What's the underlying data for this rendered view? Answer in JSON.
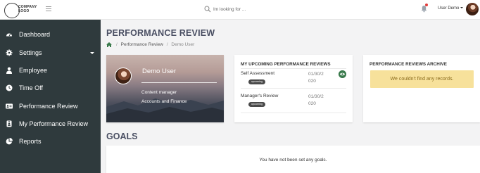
{
  "header": {
    "logo_text_line1": "COMPANY",
    "logo_text_line2": "LOGO",
    "search_placeholder": "Im looking for ...",
    "user_name": "User Demo"
  },
  "sidebar": {
    "items": [
      {
        "label": "Dashboard",
        "icon": "dashboard-icon"
      },
      {
        "label": "Settings",
        "icon": "gear-icon"
      },
      {
        "label": "Employee",
        "icon": "employee-icon"
      },
      {
        "label": "Time Off",
        "icon": "clock-icon"
      },
      {
        "label": "Performance Review",
        "icon": "id-card-icon"
      },
      {
        "label": "My Performance Review",
        "icon": "id-badge-icon"
      },
      {
        "label": "Reports",
        "icon": "pie-chart-icon"
      }
    ]
  },
  "page": {
    "title": "PERFORMANCE REVIEW",
    "breadcrumb": {
      "separator": "/",
      "item1": "Performance Review",
      "item2": "Demo User"
    }
  },
  "profile": {
    "name": "Demo User",
    "role": "Content manager",
    "department": "Accounts and Finance"
  },
  "upcoming": {
    "title": "MY UPCOMING PERFORMANCE REVIEWS",
    "reviews": [
      {
        "name": "Self Assessment",
        "badge": "upcoming",
        "date_line1": "01/30/2",
        "date_line2": "020"
      },
      {
        "name": "Manager's Review",
        "badge": "upcoming",
        "date_line1": "01/30/2",
        "date_line2": "020"
      }
    ]
  },
  "archive": {
    "title": "PERFORMANCE REVIEWS ARCHIVE",
    "empty_message": "We couldn't find any records."
  },
  "goals": {
    "title": "GOALS",
    "empty_message": "You have not been set any goals."
  },
  "colors": {
    "sidebar_bg": "#2f3a3d",
    "heading": "#4a4f63",
    "breadcrumb_home": "#3a7a4c",
    "notification_dot": "#e23c3c",
    "empty_box": "#f7e19b"
  }
}
